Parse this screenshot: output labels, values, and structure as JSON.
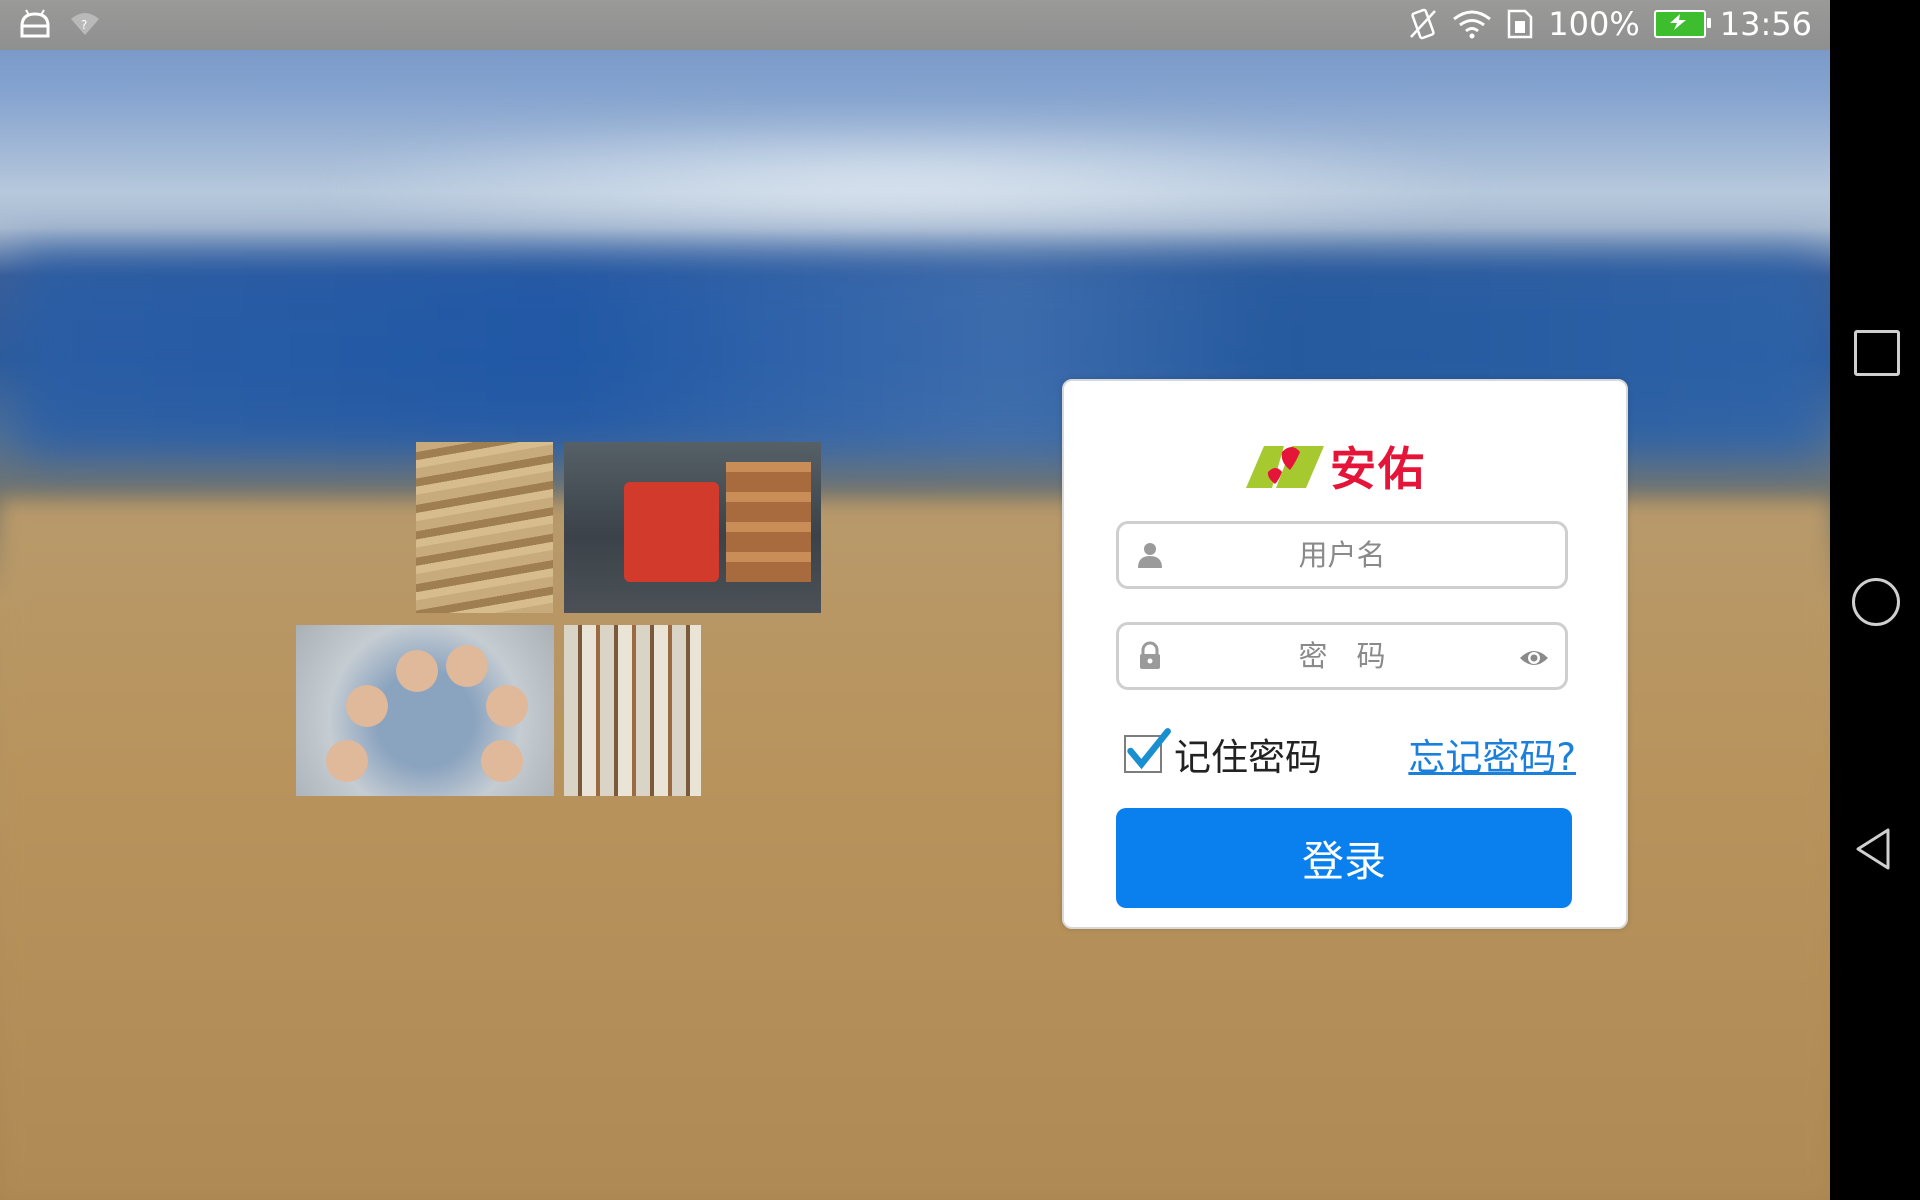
{
  "status_bar": {
    "battery": "100%",
    "time": "13:56",
    "icons": [
      "android-debug-icon",
      "wifi-question-icon",
      "vibrate-icon",
      "wifi-icon",
      "sim-icon",
      "battery-charging-icon"
    ]
  },
  "brand": {
    "name": "安佑",
    "color": "#e5153a",
    "mark_colors": [
      "#a7c930",
      "#e5153a"
    ]
  },
  "login": {
    "username_placeholder": "用户名",
    "password_placeholder": "密　码",
    "remember_label": "记住密码",
    "remember_checked": true,
    "forgot_label": "忘记密码?",
    "submit_label": "登录",
    "accent": "#0a80ef"
  },
  "nav_bar": {
    "buttons": [
      "recent-apps-icon",
      "home-icon",
      "back-icon"
    ]
  }
}
